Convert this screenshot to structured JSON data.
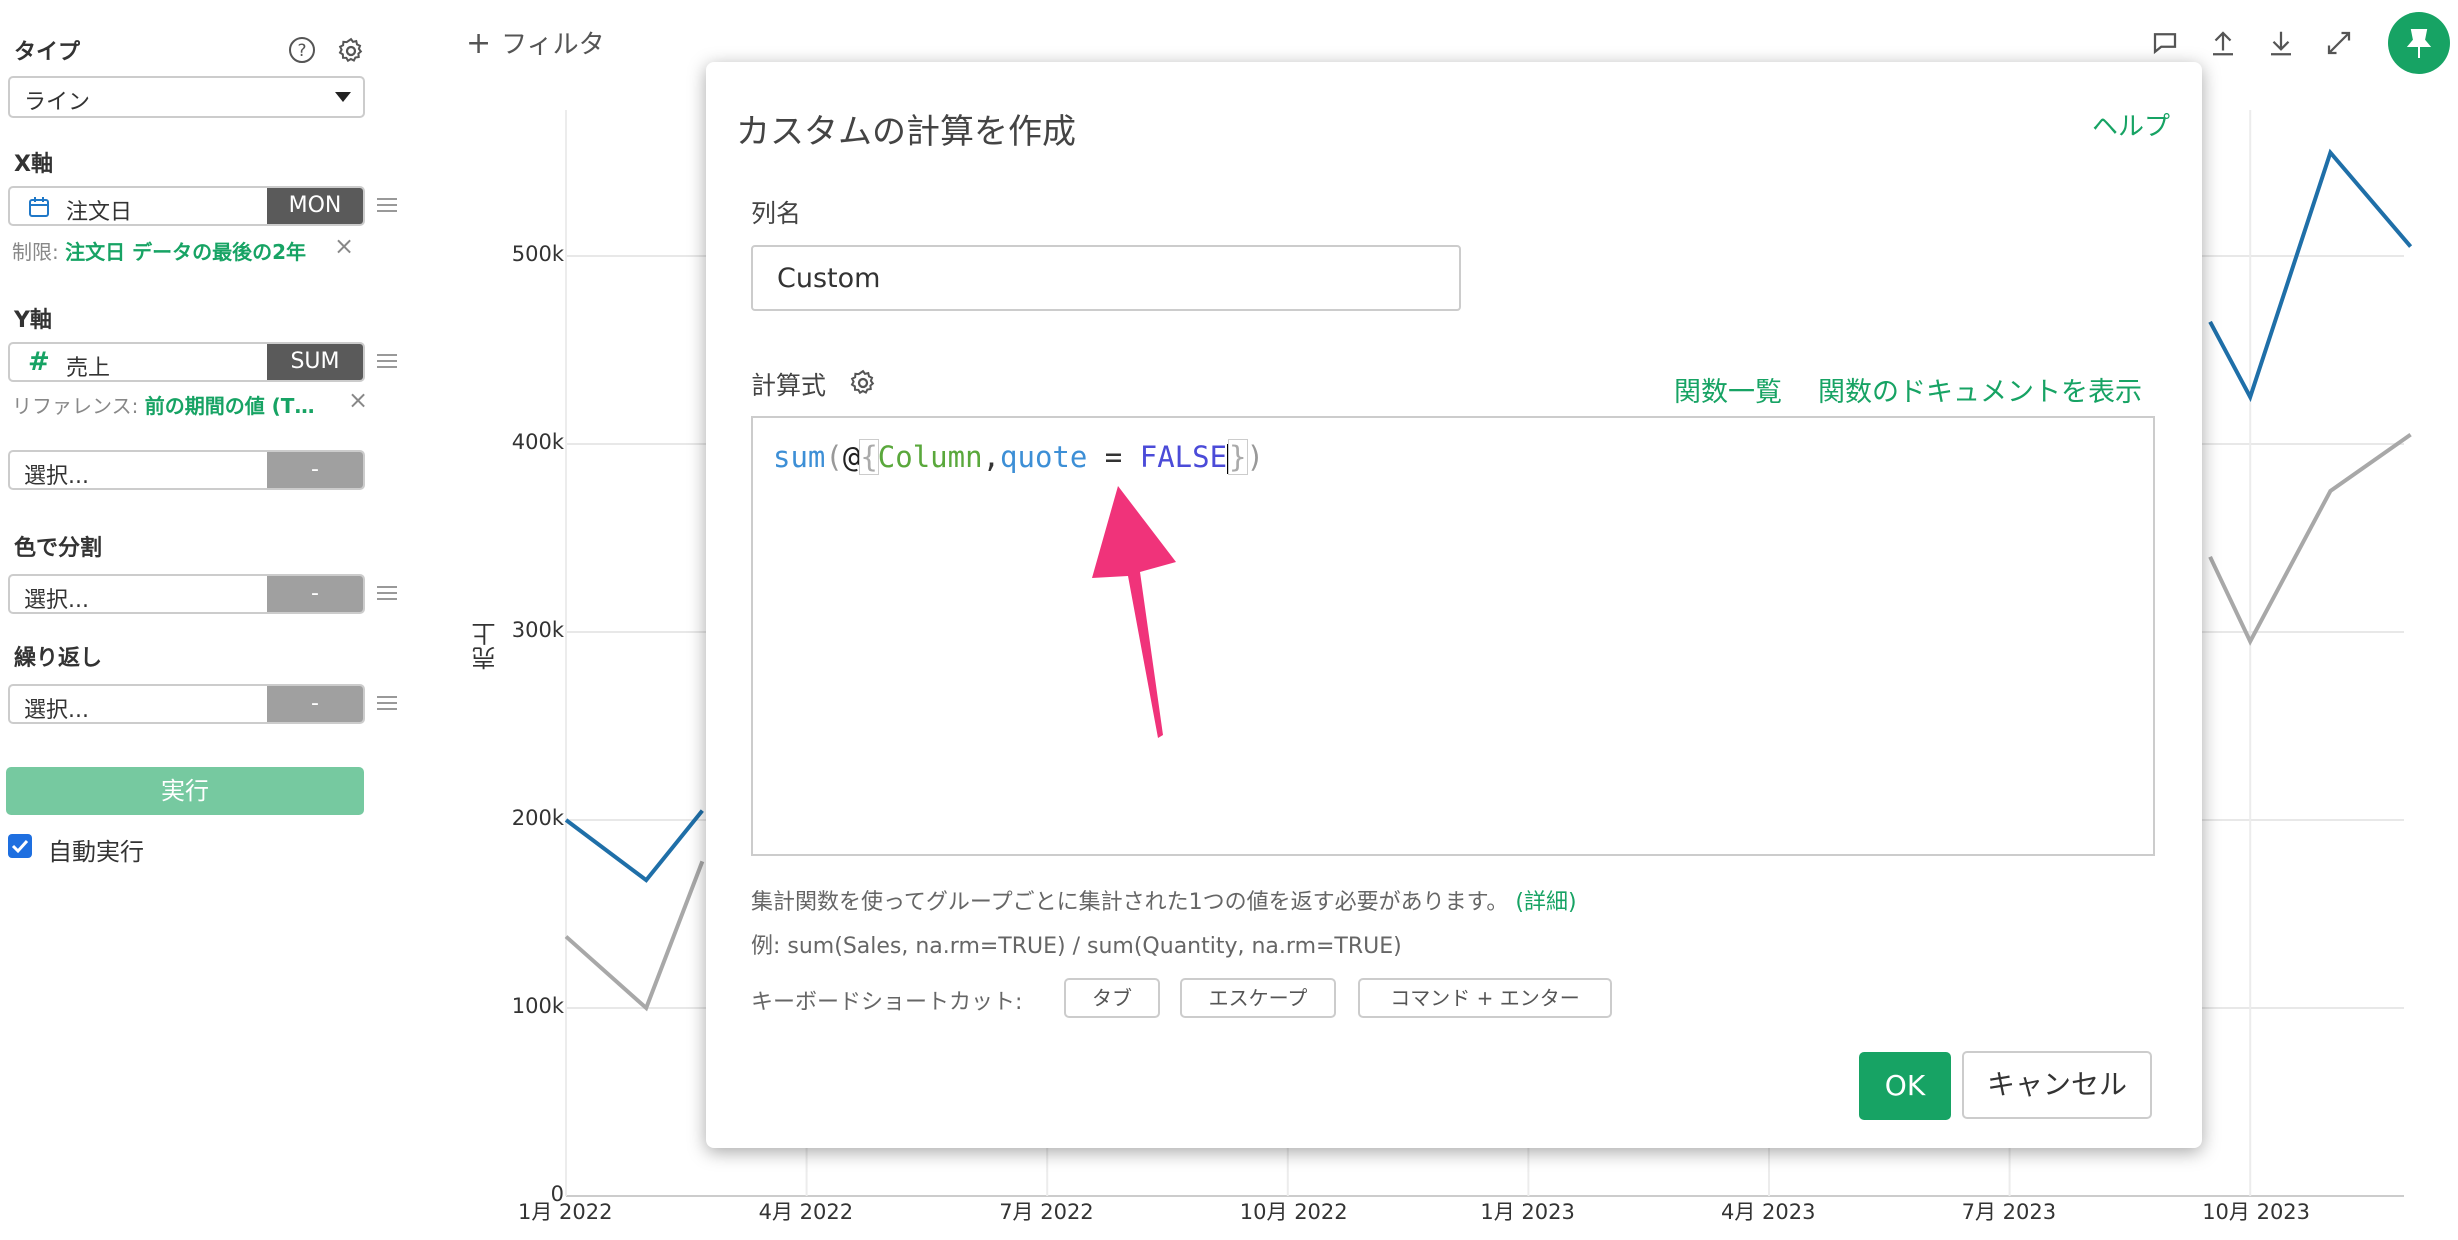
{
  "sidebar": {
    "type_label": "タイプ",
    "type_value": "ライン",
    "x_axis_label": "X軸",
    "x_field": "注文日",
    "x_agg": "MON",
    "x_limit_prefix": "制限:",
    "x_limit_value": "注文日 データの最後の2年",
    "y_axis_label": "Y軸",
    "y_field": "売上",
    "y_agg": "SUM",
    "y_ref_prefix": "リファレンス:",
    "y_ref_value": "前の期間の値 (T…",
    "select_placeholder": "選択...",
    "dash": "-",
    "color_split_label": "色で分割",
    "repeat_label": "繰り返し",
    "run_button": "実行",
    "auto_run_label": "自動実行"
  },
  "toolbar": {
    "filter_label": "フィルタ"
  },
  "chart_data": {
    "type": "line",
    "ylabel": "売上",
    "yticks": [
      "0",
      "100k",
      "200k",
      "300k",
      "400k",
      "500k"
    ],
    "xticks": [
      "1月 2022",
      "4月 2022",
      "7月 2022",
      "10月 2022",
      "1月 2023",
      "4月 2023",
      "7月 2023",
      "10月 2023"
    ],
    "ylim": [
      0,
      500000
    ],
    "series": [
      {
        "color": "#1f6fa8",
        "points_visible_left": [
          [
            0,
            200000
          ],
          [
            1,
            168000
          ],
          [
            1.7,
            205000
          ]
        ],
        "points_visible_right": [
          [
            20.5,
            465000
          ],
          [
            21,
            425000
          ],
          [
            22,
            555000
          ],
          [
            23,
            505000
          ]
        ]
      },
      {
        "color": "#a8a8a8",
        "points_visible_left": [
          [
            0,
            138000
          ],
          [
            1,
            100000
          ],
          [
            1.7,
            178000
          ]
        ],
        "points_visible_right": [
          [
            20.5,
            340000
          ],
          [
            21,
            295000
          ],
          [
            22,
            375000
          ],
          [
            23,
            405000
          ]
        ]
      }
    ]
  },
  "modal": {
    "title": "カスタムの計算を作成",
    "help": "ヘルプ",
    "column_name_label": "列名",
    "column_name_value": "Custom",
    "formula_label": "計算式",
    "function_list_link": "関数一覧",
    "function_docs_link": "関数のドキュメントを表示",
    "code": {
      "fn": "sum",
      "open": "(",
      "at": "@",
      "brace_open": "{",
      "column": "Column",
      "comma": ",",
      "param": "quote",
      "eq": " = ",
      "value": "FALSE",
      "brace_close": "}",
      "close": ")"
    },
    "note_main": "集計関数を使ってグループごとに集計された1つの値を返す必要があります。",
    "note_link": "(詳細)",
    "example": "例: sum(Sales, na.rm=TRUE) / sum(Quantity, na.rm=TRUE)",
    "shortcut_label": "キーボードショートカット:",
    "shortcut_tab": "タブ",
    "shortcut_escape": "エスケープ",
    "shortcut_command": "コマンド + エンター",
    "ok_button": "OK",
    "cancel_button": "キャンセル"
  },
  "colors": {
    "accent": "#17a364",
    "arrow": "#f0337a"
  }
}
